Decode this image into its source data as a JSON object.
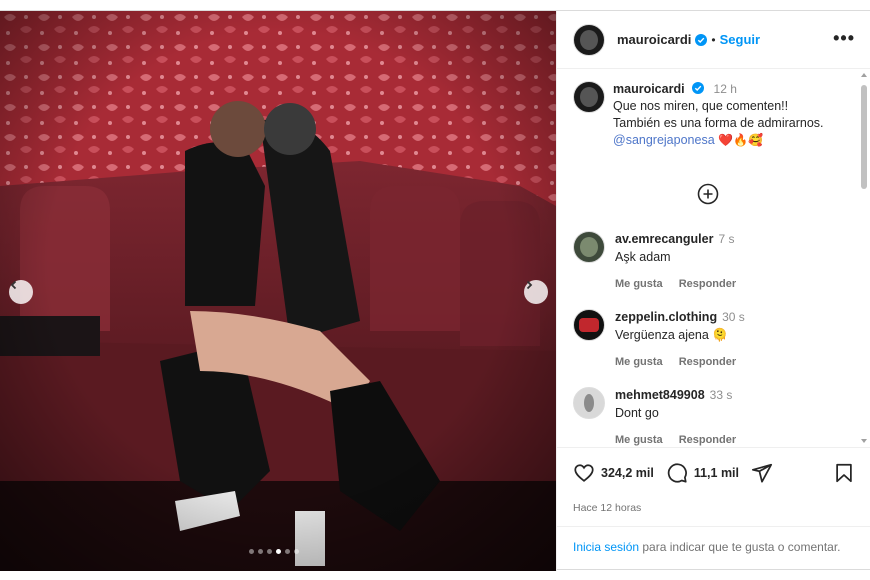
{
  "post": {
    "username": "mauroicardi",
    "follow_label": "Seguir",
    "separator": "•",
    "more_label": "•••"
  },
  "caption": {
    "username": "mauroicardi",
    "time": "12 h",
    "line1": "Que nos miren, que comenten!!",
    "line2": "También es una forma de admirarnos.",
    "mention": "@sangrejaponesa",
    "emojis": "❤️🔥🥰"
  },
  "comments": [
    {
      "username": "av.emrecanguler",
      "time": "7 s",
      "text": "Aşk adam",
      "like_label": "Me gusta",
      "reply_label": "Responder"
    },
    {
      "username": "zeppelin.clothing",
      "time": "30 s",
      "text": "Vergüenza ajena 🫠",
      "like_label": "Me gusta",
      "reply_label": "Responder"
    },
    {
      "username": "mehmet849908",
      "time": "33 s",
      "text": "Dont go",
      "like_label": "Me gusta",
      "reply_label": "Responder"
    }
  ],
  "stats": {
    "likes": "324,2 mil",
    "comments": "11,1 mil",
    "time_ago": "Hace 12 horas"
  },
  "login_prompt": {
    "link": "Inicia sesión",
    "text": " para indicar que te gusta o comentar."
  },
  "carousel": {
    "slides": 6,
    "active_index": 3
  },
  "colors": {
    "accent": "#0095f6",
    "heart": "#ed4956",
    "wall": "#b0303a",
    "sofa": "#6b1d24"
  },
  "icons": [
    "verified-badge-icon",
    "more-options-icon",
    "add-comment-icon",
    "heart-icon",
    "comment-icon",
    "share-icon",
    "bookmark-icon",
    "chevron-left-icon",
    "chevron-right-icon"
  ]
}
